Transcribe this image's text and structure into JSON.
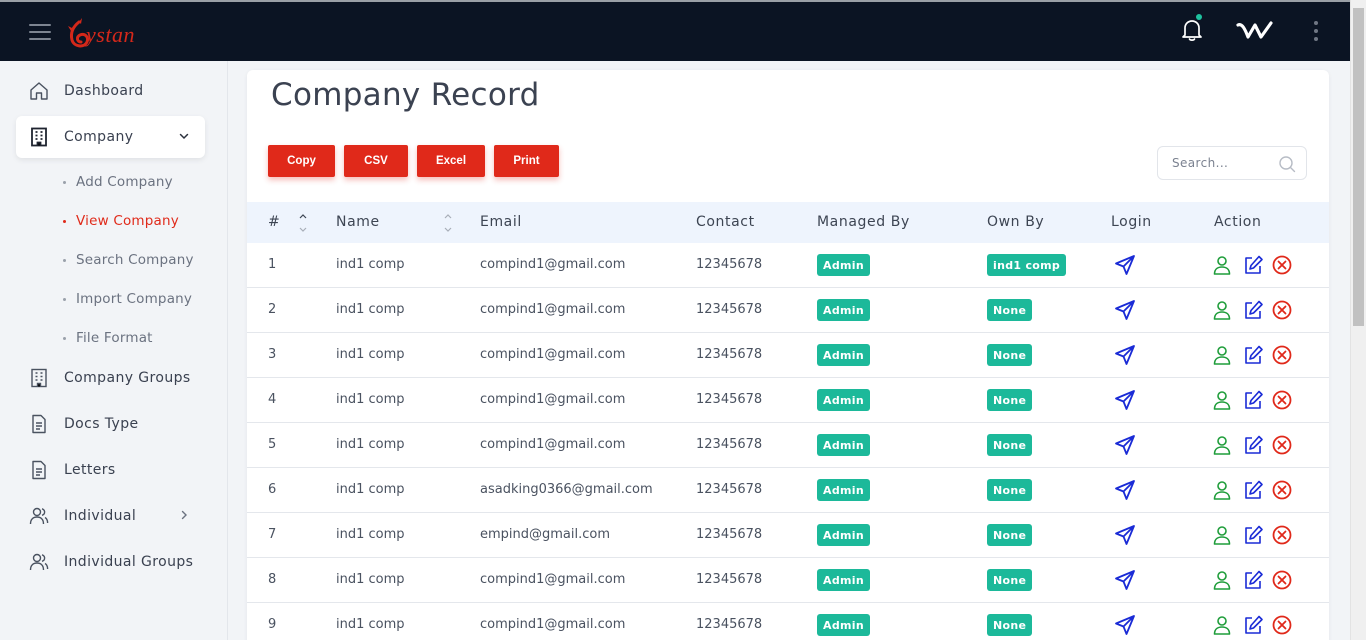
{
  "app": {
    "logo_text": "ystan"
  },
  "sidebar": {
    "items": [
      {
        "label": "Dashboard",
        "icon": "home-icon"
      },
      {
        "label": "Company",
        "icon": "building-icon"
      },
      {
        "label": "Company Groups",
        "icon": "building-icon"
      },
      {
        "label": "Docs Type",
        "icon": "document-icon"
      },
      {
        "label": "Letters",
        "icon": "document-icon"
      },
      {
        "label": "Individual",
        "icon": "users-icon"
      },
      {
        "label": "Individual Groups",
        "icon": "users-icon"
      }
    ],
    "company_sub": [
      "Add Company",
      "View Company",
      "Search Company",
      "Import Company",
      "File Format"
    ],
    "active_sub": "View Company"
  },
  "page": {
    "title": "Company Record",
    "buttons": {
      "copy": "Copy",
      "csv": "CSV",
      "excel": "Excel",
      "print": "Print"
    },
    "search_placeholder": "Search..."
  },
  "table": {
    "columns": [
      "#",
      "Name",
      "Email",
      "Contact",
      "Managed By",
      "Own By",
      "Login",
      "Action"
    ],
    "rows": [
      {
        "num": "1",
        "name": "ind1 comp",
        "email": "compind1@gmail.com",
        "contact": "12345678",
        "managed_by": "Admin",
        "own_by": "ind1 comp"
      },
      {
        "num": "2",
        "name": "ind1 comp",
        "email": "compind1@gmail.com",
        "contact": "12345678",
        "managed_by": "Admin",
        "own_by": "None"
      },
      {
        "num": "3",
        "name": "ind1 comp",
        "email": "compind1@gmail.com",
        "contact": "12345678",
        "managed_by": "Admin",
        "own_by": "None"
      },
      {
        "num": "4",
        "name": "ind1 comp",
        "email": "compind1@gmail.com",
        "contact": "12345678",
        "managed_by": "Admin",
        "own_by": "None"
      },
      {
        "num": "5",
        "name": "ind1 comp",
        "email": "compind1@gmail.com",
        "contact": "12345678",
        "managed_by": "Admin",
        "own_by": "None"
      },
      {
        "num": "6",
        "name": "ind1 comp",
        "email": "asadking0366@gmail.com",
        "contact": "12345678",
        "managed_by": "Admin",
        "own_by": "None"
      },
      {
        "num": "7",
        "name": "ind1 comp",
        "email": "empind@gmail.com",
        "contact": "12345678",
        "managed_by": "Admin",
        "own_by": "None"
      },
      {
        "num": "8",
        "name": "ind1 comp",
        "email": "compind1@gmail.com",
        "contact": "12345678",
        "managed_by": "Admin",
        "own_by": "None"
      },
      {
        "num": "9",
        "name": "ind1 comp",
        "email": "compind1@gmail.com",
        "contact": "12345678",
        "managed_by": "Admin",
        "own_by": "None"
      }
    ]
  },
  "colors": {
    "topbar": "#0b1423",
    "brand_red": "#e0291a",
    "badge_teal": "#1cb99a",
    "login_blue": "#1a2bd6",
    "user_green": "#1f9d3a",
    "edit_blue": "#1a2bd6",
    "delete_red": "#e0291a"
  }
}
